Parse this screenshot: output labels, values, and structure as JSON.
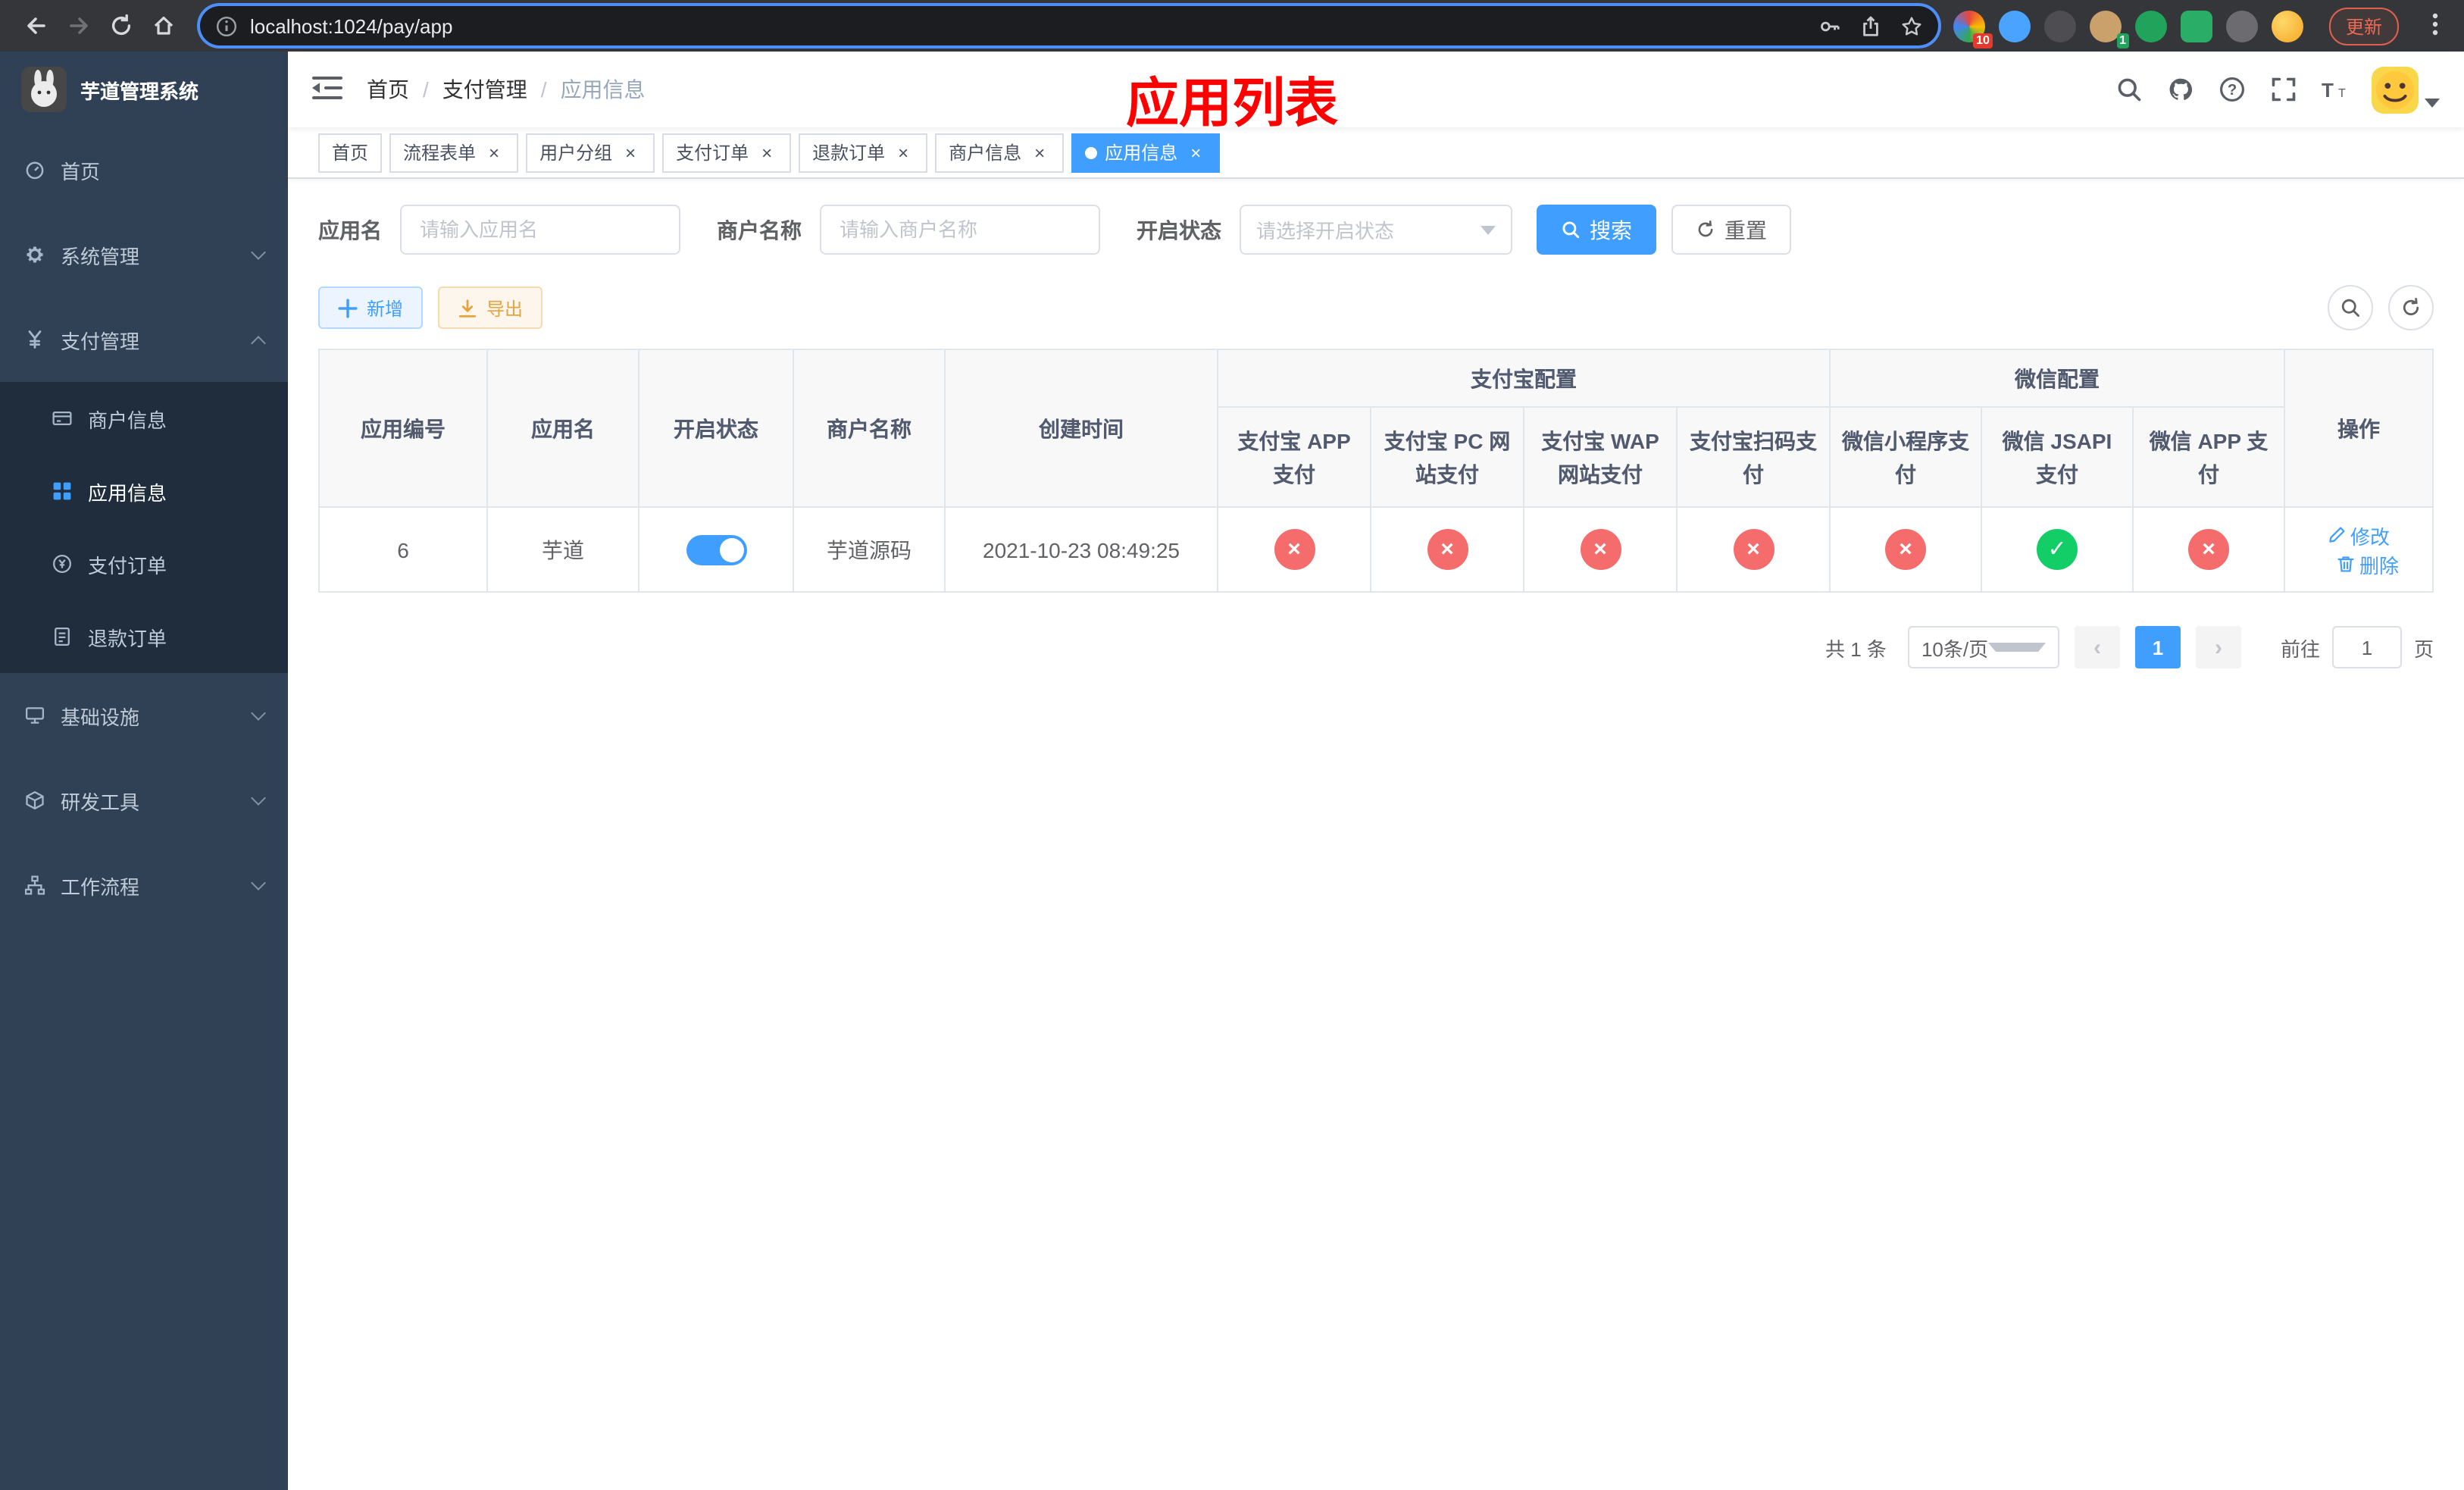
{
  "browser": {
    "url": "localhost:1024/pay/app",
    "update_label": "更新",
    "badges": {
      "extension_red": "10",
      "extension_green": "1"
    }
  },
  "sidebar": {
    "logo_title": "芋道管理系统",
    "items": {
      "home": "首页",
      "system": "系统管理",
      "payment": "支付管理",
      "merchant_info": "商户信息",
      "app_info": "应用信息",
      "pay_order": "支付订单",
      "refund_order": "退款订单",
      "infrastructure": "基础设施",
      "dev_tools": "研发工具",
      "workflow": "工作流程"
    }
  },
  "navbar": {
    "breadcrumb": {
      "home": "首页",
      "parent": "支付管理",
      "current": "应用信息"
    }
  },
  "annotation": {
    "title": "应用列表",
    "color": "#ff0000"
  },
  "tabs": [
    {
      "label": "首页"
    },
    {
      "label": "流程表单"
    },
    {
      "label": "用户分组"
    },
    {
      "label": "支付订单"
    },
    {
      "label": "退款订单"
    },
    {
      "label": "商户信息"
    },
    {
      "label": "应用信息"
    }
  ],
  "filters": {
    "app_name": {
      "label": "应用名",
      "placeholder": "请输入应用名",
      "value": ""
    },
    "merchant_name": {
      "label": "商户名称",
      "placeholder": "请输入商户名称",
      "value": ""
    },
    "status": {
      "label": "开启状态",
      "placeholder": "请选择开启状态",
      "value": ""
    },
    "search_label": "搜索",
    "reset_label": "重置"
  },
  "toolbar": {
    "add_label": "新增",
    "export_label": "导出"
  },
  "table": {
    "headers": {
      "app_id": "应用编号",
      "app_name": "应用名",
      "status": "开启状态",
      "merchant_name": "商户名称",
      "create_time": "创建时间",
      "alipay_group": "支付宝配置",
      "alipay_app": "支付宝 APP 支付",
      "alipay_pc": "支付宝 PC 网站支付",
      "alipay_wap": "支付宝 WAP 网站支付",
      "alipay_qr": "支付宝扫码支付",
      "wechat_group": "微信配置",
      "wechat_lite": "微信小程序支付",
      "wechat_jsapi": "微信 JSAPI 支付",
      "wechat_app": "微信 APP 支付",
      "actions": "操作"
    },
    "rows": [
      {
        "app_id": "6",
        "app_name": "芋道",
        "status": "on",
        "merchant_name": "芋道源码",
        "create_time": "2021-10-23 08:49:25",
        "alipay_app": "no",
        "alipay_pc": "no",
        "alipay_wap": "no",
        "alipay_qr": "no",
        "wechat_lite": "no",
        "wechat_jsapi": "yes",
        "wechat_app": "no",
        "edit_label": "修改",
        "delete_label": "删除"
      }
    ]
  },
  "pagination": {
    "total": "共 1 条",
    "page_size": "10条/页",
    "page": "1",
    "goto_label": "前往",
    "goto_value": "1",
    "page_unit": "页"
  },
  "colors": {
    "primary": "#409eff",
    "success": "#13ce66",
    "danger": "#f56c6c",
    "warning": "#e6a23c",
    "sidebar_bg": "#304156",
    "submenu_bg": "#1f2d3d"
  }
}
